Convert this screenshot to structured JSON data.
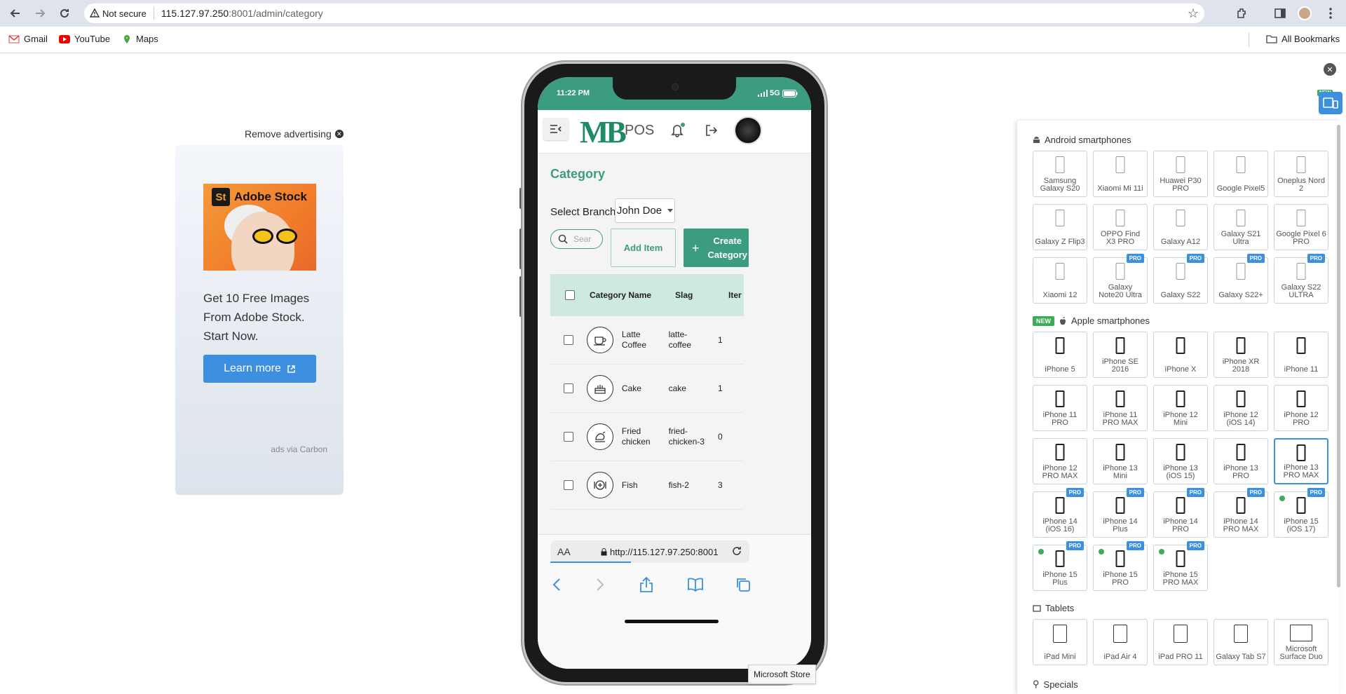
{
  "browser": {
    "not_secure": "Not secure",
    "url_host": "115.127.97.250",
    "url_path": ":8001/admin/category",
    "bookmarks": [
      "Gmail",
      "YouTube",
      "Maps"
    ],
    "all_bookmarks": "All Bookmarks"
  },
  "ad": {
    "remove": "Remove advertising",
    "brand": "Adobe Stock",
    "brand_mark": "St",
    "text_lines": [
      "Get 10 Free Images",
      "From Adobe Stock.",
      "Start Now."
    ],
    "button": "Learn more",
    "via": "ads via Carbon"
  },
  "phone": {
    "time": "11:22 PM",
    "network": "5G",
    "logo": "MB",
    "logo_suffix": "POS",
    "page_title": "Category",
    "branch_label": "Select Branch",
    "branch_value": "John Doe",
    "search_placeholder": "Sear",
    "add_item": "Add Item",
    "create_category_lines": [
      "Create",
      "Category"
    ],
    "columns": [
      "Category Name",
      "Slag",
      "Iter"
    ],
    "rows": [
      {
        "name_lines": [
          "Latte",
          "Coffee"
        ],
        "slug_lines": [
          "latte-",
          "coffee"
        ],
        "items": "1",
        "icon": "coffee-cup-icon"
      },
      {
        "name_lines": [
          "Cake",
          ""
        ],
        "slug_lines": [
          "cake",
          ""
        ],
        "items": "1",
        "icon": "cake-icon"
      },
      {
        "name_lines": [
          "Fried",
          "chicken"
        ],
        "slug_lines": [
          "fried-",
          "chicken-3"
        ],
        "items": "0",
        "icon": "chicken-icon"
      },
      {
        "name_lines": [
          "Fish",
          ""
        ],
        "slug_lines": [
          "fish-2",
          ""
        ],
        "items": "3",
        "icon": "fish-icon"
      }
    ],
    "address_aa": "AA",
    "address_url": "http://115.127.97.250:8001"
  },
  "tooltip": "Microsoft Store",
  "panel": {
    "android_title": "Android smartphones",
    "apple_title": "Apple smartphones",
    "tablets_title": "Tablets",
    "specials_title": "Specials",
    "new_badge": "NEW",
    "pro_badge": "PRO",
    "android": [
      {
        "label": "Samsung Galaxy S20",
        "pro": false
      },
      {
        "label": "Xiaomi Mi 11i",
        "pro": false
      },
      {
        "label": "Huawei P30 PRO",
        "pro": false
      },
      {
        "label": "Google Pixel5",
        "pro": false
      },
      {
        "label": "Oneplus Nord 2",
        "pro": false
      },
      {
        "label": "Galaxy Z Flip3",
        "pro": false
      },
      {
        "label": "OPPO Find X3 PRO",
        "pro": false
      },
      {
        "label": "Galaxy A12",
        "pro": false
      },
      {
        "label": "Galaxy S21 Ultra",
        "pro": false
      },
      {
        "label": "Google Pixel 6 PRO",
        "pro": false
      },
      {
        "label": "Xiaomi 12",
        "pro": false
      },
      {
        "label": "Galaxy Note20 Ultra",
        "pro": true
      },
      {
        "label": "Galaxy S22",
        "pro": true
      },
      {
        "label": "Galaxy S22+",
        "pro": true
      },
      {
        "label": "Galaxy S22 ULTRA",
        "pro": true
      }
    ],
    "apple": [
      {
        "label": "iPhone 5",
        "pro": false,
        "dot": false
      },
      {
        "label": "iPhone SE 2016",
        "pro": false,
        "dot": false
      },
      {
        "label": "iPhone X",
        "pro": false,
        "dot": false
      },
      {
        "label": "iPhone XR 2018",
        "pro": false,
        "dot": false
      },
      {
        "label": "iPhone 11",
        "pro": false,
        "dot": false
      },
      {
        "label": "iPhone 11 PRO",
        "pro": false,
        "dot": false
      },
      {
        "label": "iPhone 11 PRO MAX",
        "pro": false,
        "dot": false
      },
      {
        "label": "iPhone 12 Mini",
        "pro": false,
        "dot": false
      },
      {
        "label": "iPhone 12 (iOS 14)",
        "pro": false,
        "dot": false
      },
      {
        "label": "iPhone 12 PRO",
        "pro": false,
        "dot": false
      },
      {
        "label": "iPhone 12 PRO MAX",
        "pro": false,
        "dot": false
      },
      {
        "label": "iPhone 13 Mini",
        "pro": false,
        "dot": false
      },
      {
        "label": "iPhone 13 (iOS 15)",
        "pro": false,
        "dot": false
      },
      {
        "label": "iPhone 13 PRO",
        "pro": false,
        "dot": false
      },
      {
        "label": "iPhone 13 PRO MAX",
        "pro": false,
        "dot": false,
        "selected": true
      },
      {
        "label": "iPhone 14 (iOS 16)",
        "pro": true,
        "dot": false
      },
      {
        "label": "iPhone 14 Plus",
        "pro": true,
        "dot": false
      },
      {
        "label": "iPhone 14 PRO",
        "pro": true,
        "dot": false
      },
      {
        "label": "iPhone 14 PRO MAX",
        "pro": true,
        "dot": false
      },
      {
        "label": "iPhone 15 (iOS 17)",
        "pro": true,
        "dot": true
      },
      {
        "label": "iPhone 15 Plus",
        "pro": true,
        "dot": true
      },
      {
        "label": "iPhone 15 PRO",
        "pro": true,
        "dot": true
      },
      {
        "label": "iPhone 15 PRO MAX",
        "pro": true,
        "dot": true
      }
    ],
    "tablets": [
      {
        "label": "iPad Mini"
      },
      {
        "label": "iPad Air 4"
      },
      {
        "label": "iPad PRO 11"
      },
      {
        "label": "Galaxy Tab S7"
      },
      {
        "label": "Microsoft Surface Duo"
      }
    ]
  }
}
